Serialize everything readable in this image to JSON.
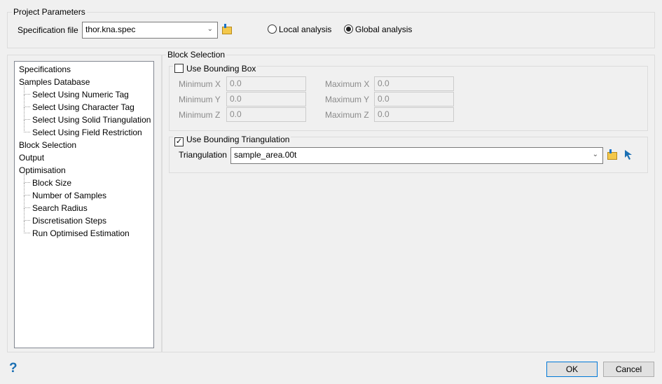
{
  "project": {
    "legend": "Project Parameters",
    "spec_label": "Specification file",
    "spec_value": "thor.kna.spec",
    "local": "Local analysis",
    "global": "Global analysis",
    "selected": "global"
  },
  "tree": [
    {
      "label": "Specifications",
      "level": 0
    },
    {
      "label": "Samples Database",
      "level": 0
    },
    {
      "label": "Select Using Numeric Tag",
      "level": 1
    },
    {
      "label": "Select Using Character Tag",
      "level": 1
    },
    {
      "label": "Select Using Solid Triangulation",
      "level": 1
    },
    {
      "label": "Select Using Field Restriction",
      "level": 1
    },
    {
      "label": "Block Selection",
      "level": 0
    },
    {
      "label": "Output",
      "level": 0
    },
    {
      "label": "Optimisation",
      "level": 0
    },
    {
      "label": "Block Size",
      "level": 1
    },
    {
      "label": "Number of Samples",
      "level": 1
    },
    {
      "label": "Search Radius",
      "level": 1
    },
    {
      "label": "Discretisation Steps",
      "level": 1
    },
    {
      "label": "Run Optimised Estimation",
      "level": 1
    }
  ],
  "block": {
    "legend": "Block Selection",
    "bbox": {
      "label": "Use Bounding Box",
      "checked": false,
      "min_x_label": "Minimum X",
      "min_x": "0.0",
      "min_y_label": "Minimum Y",
      "min_y": "0.0",
      "min_z_label": "Minimum Z",
      "min_z": "0.0",
      "max_x_label": "Maximum X",
      "max_x": "0.0",
      "max_y_label": "Maximum Y",
      "max_y": "0.0",
      "max_z_label": "Maximum Z",
      "max_z": "0.0"
    },
    "tri": {
      "label": "Use Bounding Triangulation",
      "checked": true,
      "field_label": "Triangulation",
      "value": "sample_area.00t"
    }
  },
  "footer": {
    "help": "?",
    "ok": "OK",
    "cancel": "Cancel"
  }
}
